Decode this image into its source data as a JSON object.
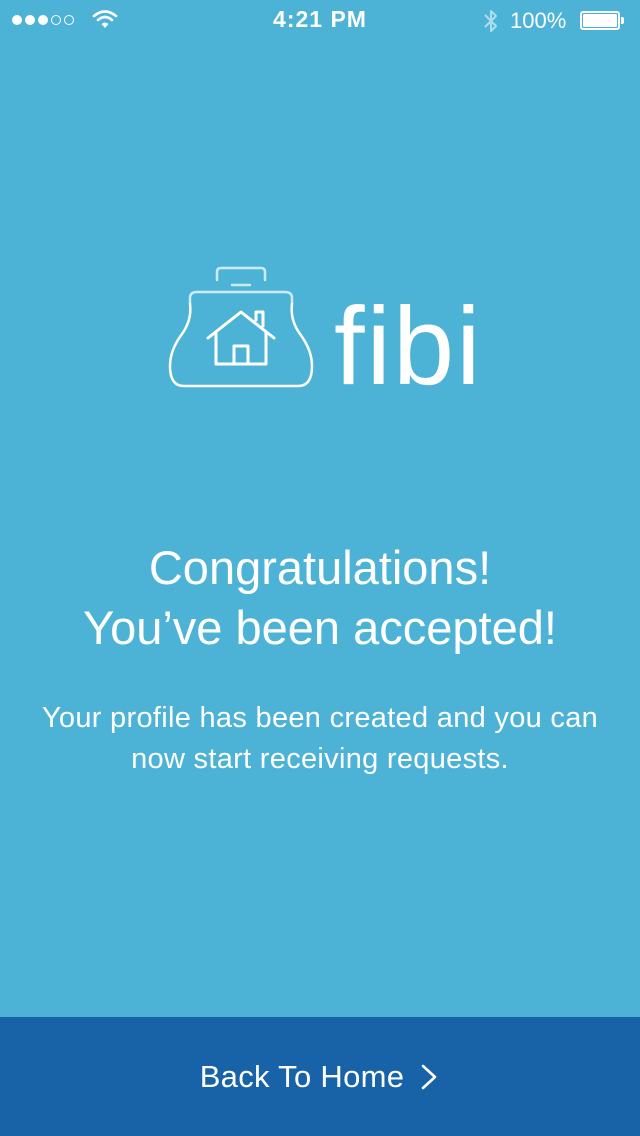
{
  "theme": {
    "background": "#4db3d6",
    "bottom_bar": "#1862a8",
    "text": "#ffffff"
  },
  "status_bar": {
    "signal_bars_filled": 3,
    "signal_bars_total": 5,
    "wifi_icon": "wifi-icon",
    "time": "4:21 PM",
    "bluetooth_icon": "bluetooth-icon",
    "battery_percent_label": "100%",
    "battery_level": 1.0
  },
  "logo": {
    "icon": "house-bag-icon",
    "wordmark": "fibi"
  },
  "message": {
    "headline_line1": "Congratulations!",
    "headline_line2": "You’ve been accepted!",
    "body": "Your profile has been created and you can now start receiving requests."
  },
  "bottom_action": {
    "label": "Back To Home",
    "icon": "chevron-right-icon"
  }
}
